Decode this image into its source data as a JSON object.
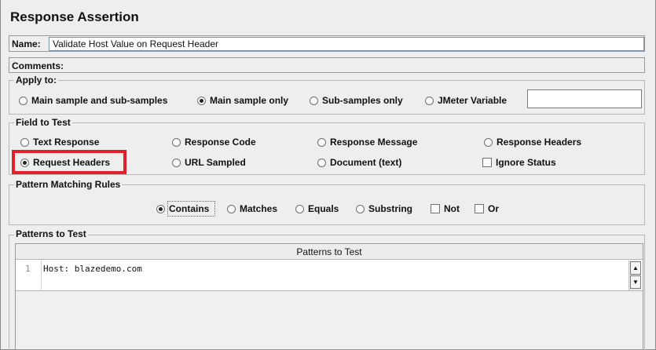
{
  "panel": {
    "title": "Response Assertion",
    "name_label": "Name:",
    "name_value": "Validate Host Value on Request Header",
    "comments_label": "Comments:"
  },
  "apply_to": {
    "legend": "Apply to:",
    "options": [
      {
        "label": "Main sample and sub-samples",
        "selected": false
      },
      {
        "label": "Main sample only",
        "selected": true
      },
      {
        "label": "Sub-samples only",
        "selected": false
      },
      {
        "label": "JMeter Variable",
        "selected": false
      }
    ],
    "variable_value": ""
  },
  "field_to_test": {
    "legend": "Field to Test",
    "options": [
      {
        "label": "Text Response",
        "selected": false
      },
      {
        "label": "Response Code",
        "selected": false
      },
      {
        "label": "Response Message",
        "selected": false
      },
      {
        "label": "Response Headers",
        "selected": false
      },
      {
        "label": "Request Headers",
        "selected": true
      },
      {
        "label": "URL Sampled",
        "selected": false
      },
      {
        "label": "Document (text)",
        "selected": false
      }
    ],
    "ignore_status_label": "Ignore Status",
    "ignore_status_checked": false,
    "highlight_color": "#e2202a"
  },
  "pattern_matching": {
    "legend": "Pattern Matching Rules",
    "options": [
      {
        "label": "Contains",
        "selected": true
      },
      {
        "label": "Matches",
        "selected": false
      },
      {
        "label": "Equals",
        "selected": false
      },
      {
        "label": "Substring",
        "selected": false
      }
    ],
    "not_label": "Not",
    "or_label": "Or"
  },
  "patterns": {
    "legend": "Patterns to Test",
    "column_header": "Patterns to Test",
    "line_number": "1",
    "rows": [
      "Host: blazedemo.com"
    ]
  }
}
